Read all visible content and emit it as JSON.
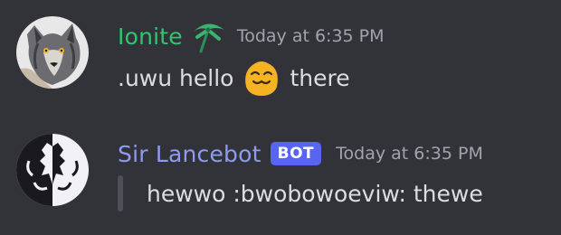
{
  "messages": [
    {
      "username": "Ionite",
      "role_icon": "palm-tree-icon",
      "timestamp": "Today at 6:35 PM",
      "text_before": ".uwu hello",
      "emoji": "blob-uwu-emoji",
      "text_after": "there",
      "name_color": "#2dc770"
    },
    {
      "username": "Sir Lancebot",
      "bot_tag": "BOT",
      "timestamp": "Today at 6:35 PM",
      "quote": "hewwo :bwobowoeviw: thewe",
      "name_color": "#8e9bf0"
    }
  ],
  "theme": {
    "background": "#313338",
    "text": "#dbdee1",
    "timestamp": "#a0a4ab",
    "bot_tag": "#5865f2",
    "quote_bar": "#4e5058"
  }
}
